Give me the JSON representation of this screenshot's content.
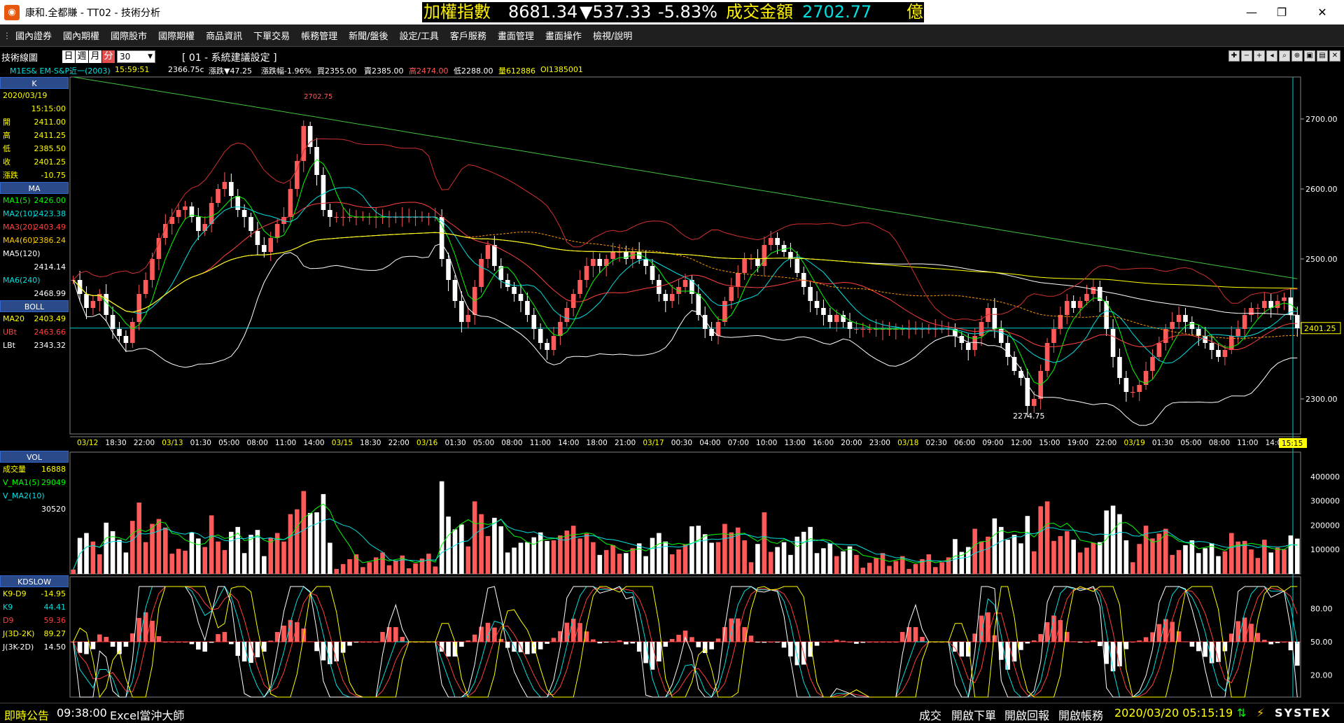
{
  "window": {
    "title": "康和.全都賺 - TT02 - 技術分析",
    "ticker": {
      "name": "加權指數",
      "value": "8681.34",
      "change": "▼537.33",
      "pct": "-5.83%",
      "vol_label": "成交金額",
      "vol_value": "2702.77",
      "unit": "億"
    },
    "minimize": "—",
    "restore": "❐",
    "close": "✕"
  },
  "menu": [
    "國內證券",
    "國內期權",
    "國際股市",
    "國際期權",
    "商品資訊",
    "下單交易",
    "帳務管理",
    "新聞/盤後",
    "設定/工具",
    "客戶服務",
    "畫面管理",
    "畫面操作",
    "檢視/說明"
  ],
  "toolbar": {
    "label": "技術線圖",
    "periods": [
      "日",
      "週",
      "月",
      "分"
    ],
    "interval": "30",
    "config": "[ 01 - 系統建議設定 ]"
  },
  "quote": {
    "symbol": "M1ES& EM-S&P近一(2003)",
    "time": "15:59:51",
    "last": "2366.75c",
    "chg": "漲跌▼47.25",
    "pct": "漲跌幅-1.96%",
    "bid": "買2355.00",
    "ask": "賣2385.00",
    "high": "高2474.00",
    "low": "低2288.00",
    "vol": "量612886",
    "oi": "OI1385001"
  },
  "colors": {
    "up": "#ff5a5a",
    "down": "#ffffff",
    "ma5": "#00ff00",
    "ma10": "#00e0e0",
    "ma20": "#ff4040",
    "ma60": "#ff9900",
    "ma120": "#ffffff",
    "ma240": "#ffff00",
    "accent": "#00d0d0"
  },
  "side_k": {
    "head": "K",
    "date": "2020/03/19",
    "time": "15:15:00",
    "rows": [
      {
        "label": "開",
        "value": "2411.00"
      },
      {
        "label": "高",
        "value": "2411.25"
      },
      {
        "label": "低",
        "value": "2385.50"
      },
      {
        "label": "收",
        "value": "2401.25"
      },
      {
        "label": "漲跌",
        "value": "-10.75"
      }
    ]
  },
  "side_ma": {
    "head": "MA",
    "rows": [
      {
        "label": "MA1(5)",
        "value": "2426.00"
      },
      {
        "label": "MA2(10)",
        "value": "2423.38"
      },
      {
        "label": "MA3(20)",
        "value": "2403.49"
      },
      {
        "label": "MA4(60)",
        "value": "2386.24"
      },
      {
        "label": "MA5(120)",
        "value": ""
      },
      {
        "label": "",
        "value": "2414.14"
      },
      {
        "label": "MA6(240)",
        "value": ""
      },
      {
        "label": "",
        "value": "2468.99"
      }
    ]
  },
  "side_boll": {
    "head": "BOLL",
    "rows": [
      {
        "label": "MA20",
        "value": "2403.49"
      },
      {
        "label": "UBt",
        "value": "2463.66"
      },
      {
        "label": "LBt",
        "value": "2343.32"
      }
    ]
  },
  "side_vol": {
    "head": "VOL",
    "rows": [
      {
        "label": "成交量",
        "value": "16888"
      },
      {
        "label": "V_MA1(5)",
        "value": "29049"
      },
      {
        "label": "V_MA2(10)",
        "value": ""
      },
      {
        "label": "",
        "value": "30520"
      }
    ]
  },
  "side_kd": {
    "head": "KDSLOW",
    "rows": [
      {
        "label": "K9-D9",
        "value": "-14.95"
      },
      {
        "label": "K9",
        "value": "44.41"
      },
      {
        "label": "D9",
        "value": "59.36"
      },
      {
        "label": "J(3D-2K)",
        "value": "89.27"
      },
      {
        "label": "J(3K-2D)",
        "value": "14.50"
      }
    ]
  },
  "price_axis": [
    "2700.00",
    "2600.00",
    "2500.00",
    "2400.00",
    "2300.00"
  ],
  "price_marker": "2401.25",
  "vol_axis": [
    "400000",
    "300000",
    "200000",
    "100000"
  ],
  "kd_axis": [
    "80.00",
    "50.00",
    "20.00"
  ],
  "high_mark": "2702.75",
  "low_mark": "2274.75",
  "time_axis": [
    {
      "t": "03/12",
      "d": true
    },
    {
      "t": "18:30"
    },
    {
      "t": "22:00"
    },
    {
      "t": "03/13",
      "d": true
    },
    {
      "t": "01:30"
    },
    {
      "t": "05:00"
    },
    {
      "t": "08:00"
    },
    {
      "t": "11:00"
    },
    {
      "t": "14:00"
    },
    {
      "t": "03/15",
      "d": true
    },
    {
      "t": "18:30"
    },
    {
      "t": "22:00"
    },
    {
      "t": "03/16",
      "d": true
    },
    {
      "t": "01:30"
    },
    {
      "t": "05:00"
    },
    {
      "t": "08:00"
    },
    {
      "t": "11:00"
    },
    {
      "t": "14:00"
    },
    {
      "t": "18:00"
    },
    {
      "t": "21:00"
    },
    {
      "t": "03/17",
      "d": true
    },
    {
      "t": "00:30"
    },
    {
      "t": "04:00"
    },
    {
      "t": "07:00"
    },
    {
      "t": "10:00"
    },
    {
      "t": "13:00"
    },
    {
      "t": "16:00"
    },
    {
      "t": "20:00"
    },
    {
      "t": "23:00"
    },
    {
      "t": "03/18",
      "d": true
    },
    {
      "t": "02:30"
    },
    {
      "t": "06:00"
    },
    {
      "t": "09:00"
    },
    {
      "t": "12:00"
    },
    {
      "t": "15:00"
    },
    {
      "t": "19:00"
    },
    {
      "t": "22:00"
    },
    {
      "t": "03/19",
      "d": true
    },
    {
      "t": "01:30"
    },
    {
      "t": "05:00"
    },
    {
      "t": "08:00"
    },
    {
      "t": "11:00"
    },
    {
      "t": "14:00"
    }
  ],
  "time_cursor": "15:15",
  "status": {
    "news_label": "即時公告",
    "news_time": "09:38:00",
    "news_text": "Excel當沖大師",
    "btn1": "成交",
    "btn2": "開啟下單",
    "btn3": "開啟回報",
    "btn4": "開啟帳務",
    "datetime": "2020/03/20 05:15:19",
    "brand": "SYSTEX"
  },
  "chart_data": {
    "type": "candlestick",
    "symbol": "M1ES& EM-S&P近一(2003)",
    "price_range": [
      2250,
      2760
    ],
    "closes": [
      2470,
      2450,
      2430,
      2440,
      2450,
      2420,
      2400,
      2390,
      2380,
      2410,
      2450,
      2470,
      2500,
      2530,
      2550,
      2560,
      2570,
      2575,
      2560,
      2540,
      2550,
      2580,
      2600,
      2610,
      2590,
      2570,
      2560,
      2540,
      2520,
      2510,
      2530,
      2550,
      2560,
      2600,
      2640,
      2690,
      2660,
      2620,
      2570,
      2560,
      2560,
      2560,
      2560,
      2560,
      2560,
      2560,
      2560,
      2560,
      2560,
      2560,
      2560,
      2560,
      2560,
      2560,
      2560,
      2560,
      2500,
      2470,
      2440,
      2410,
      2420,
      2460,
      2500,
      2520,
      2490,
      2470,
      2460,
      2450,
      2440,
      2420,
      2400,
      2380,
      2370,
      2390,
      2410,
      2430,
      2450,
      2470,
      2490,
      2500,
      2490,
      2500,
      2510,
      2510,
      2500,
      2510,
      2500,
      2490,
      2470,
      2450,
      2440,
      2450,
      2460,
      2470,
      2450,
      2420,
      2400,
      2390,
      2410,
      2440,
      2460,
      2480,
      2500,
      2500,
      2490,
      2520,
      2530,
      2520,
      2510,
      2500,
      2480,
      2460,
      2440,
      2430,
      2420,
      2410,
      2420,
      2410,
      2400,
      2400,
      2400,
      2400,
      2400,
      2400,
      2400,
      2400,
      2400,
      2400,
      2400,
      2400,
      2400,
      2400,
      2400,
      2400,
      2390,
      2380,
      2370,
      2390,
      2410,
      2430,
      2400,
      2380,
      2360,
      2340,
      2330,
      2290,
      2300,
      2340,
      2380,
      2400,
      2420,
      2440,
      2430,
      2440,
      2450,
      2460,
      2440,
      2400,
      2360,
      2330,
      2310,
      2310,
      2320,
      2340,
      2360,
      2380,
      2400,
      2410,
      2420,
      2410,
      2400,
      2390,
      2380,
      2370,
      2360,
      2370,
      2390,
      2400,
      2420,
      2430,
      2430,
      2440,
      2430,
      2440,
      2445,
      2420,
      2401
    ],
    "volume_range": [
      0,
      460000
    ],
    "kd_range": [
      0,
      100
    ]
  }
}
